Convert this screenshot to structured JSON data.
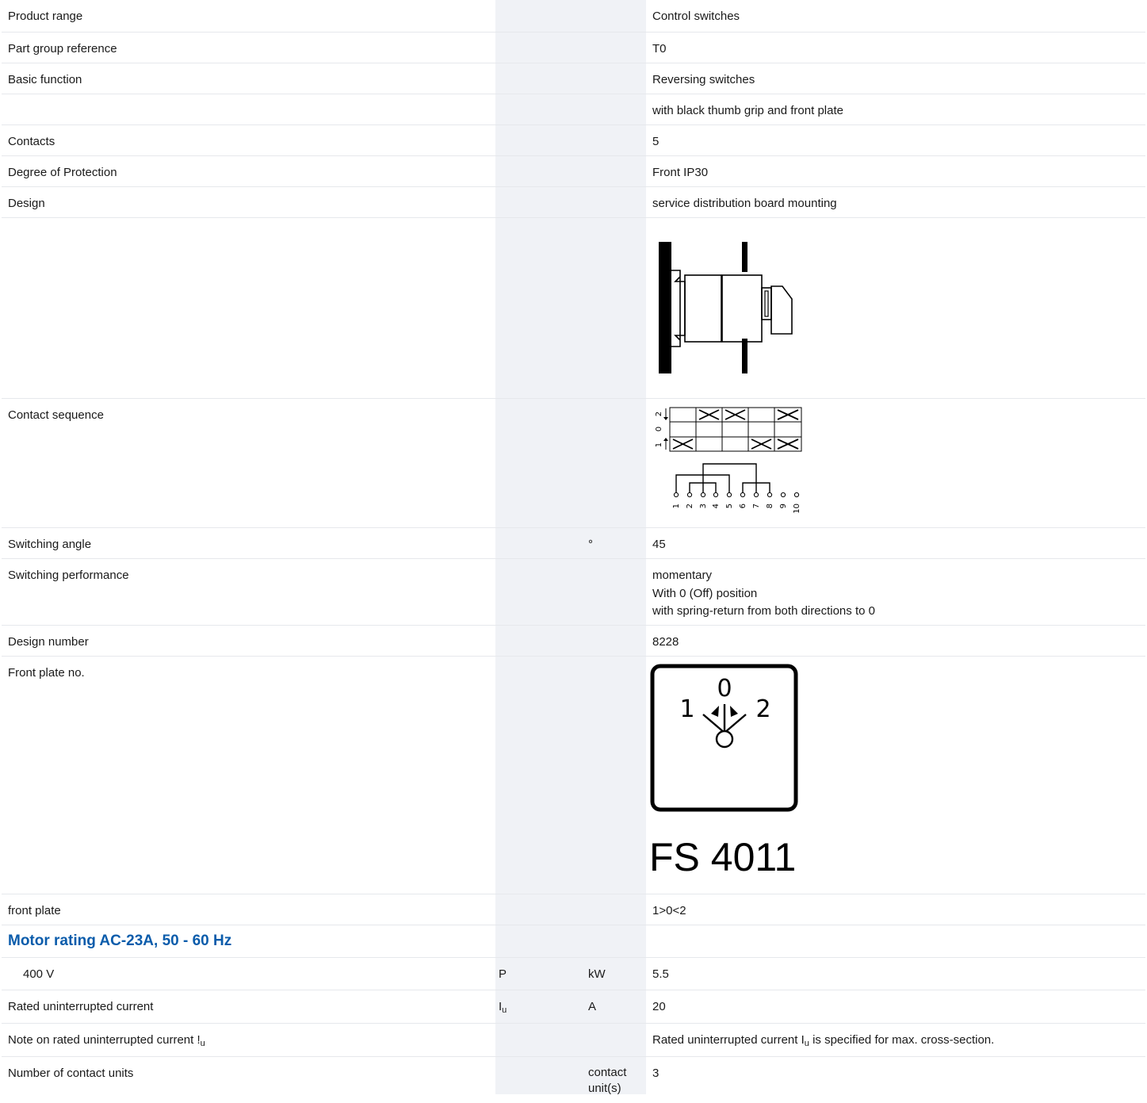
{
  "rows": [
    {
      "label": "Product range",
      "value": "Control switches"
    },
    {
      "label": "Part group reference",
      "value": "T0"
    },
    {
      "label": "Basic function",
      "value": "Reversing switches"
    },
    {
      "label": "",
      "value": "with black thumb grip and front plate"
    },
    {
      "label": "Contacts",
      "value": "5"
    },
    {
      "label": "Degree of Protection",
      "value": "Front IP30"
    },
    {
      "label": "Design",
      "value": "service distribution board mounting"
    },
    {
      "label": "Contact sequence"
    },
    {
      "label": "Switching angle",
      "unit": "°",
      "value": "45"
    },
    {
      "label": "Switching performance",
      "lines": [
        "momentary",
        "With 0 (Off) position",
        "with spring-return from both directions to 0"
      ]
    },
    {
      "label": "Design number",
      "value": "8228"
    },
    {
      "label": "Front plate no."
    },
    {
      "label": "front plate",
      "value": "1>0<2"
    }
  ],
  "section": {
    "title": "Motor rating AC-23A, 50 - 60 Hz"
  },
  "motor": {
    "label": "400 V",
    "symbol": "P",
    "unit": "kW",
    "value": "5.5"
  },
  "current": {
    "label": "Rated uninterrupted current",
    "symbol": "I",
    "symbol_sub": "u",
    "unit": "A",
    "value": "20"
  },
  "note": {
    "label": "Note on rated uninterrupted current !",
    "label_sub": "u",
    "value_pre": "Rated uninterrupted current I",
    "value_sub": "u",
    "value_post": " is specified for max. cross-section."
  },
  "contact_units": {
    "label": "Number of contact units",
    "unit_line1": "contact",
    "unit_line2": "unit(s)",
    "value": "3"
  },
  "contact_sequence": {
    "positions": [
      "2",
      "0",
      "1"
    ],
    "terminals": [
      "1",
      "2",
      "3",
      "4",
      "5",
      "6",
      "7",
      "8",
      "9",
      "10"
    ]
  },
  "front_plate": {
    "positions": [
      "1",
      "0",
      "2"
    ],
    "code": "FS 4011"
  }
}
